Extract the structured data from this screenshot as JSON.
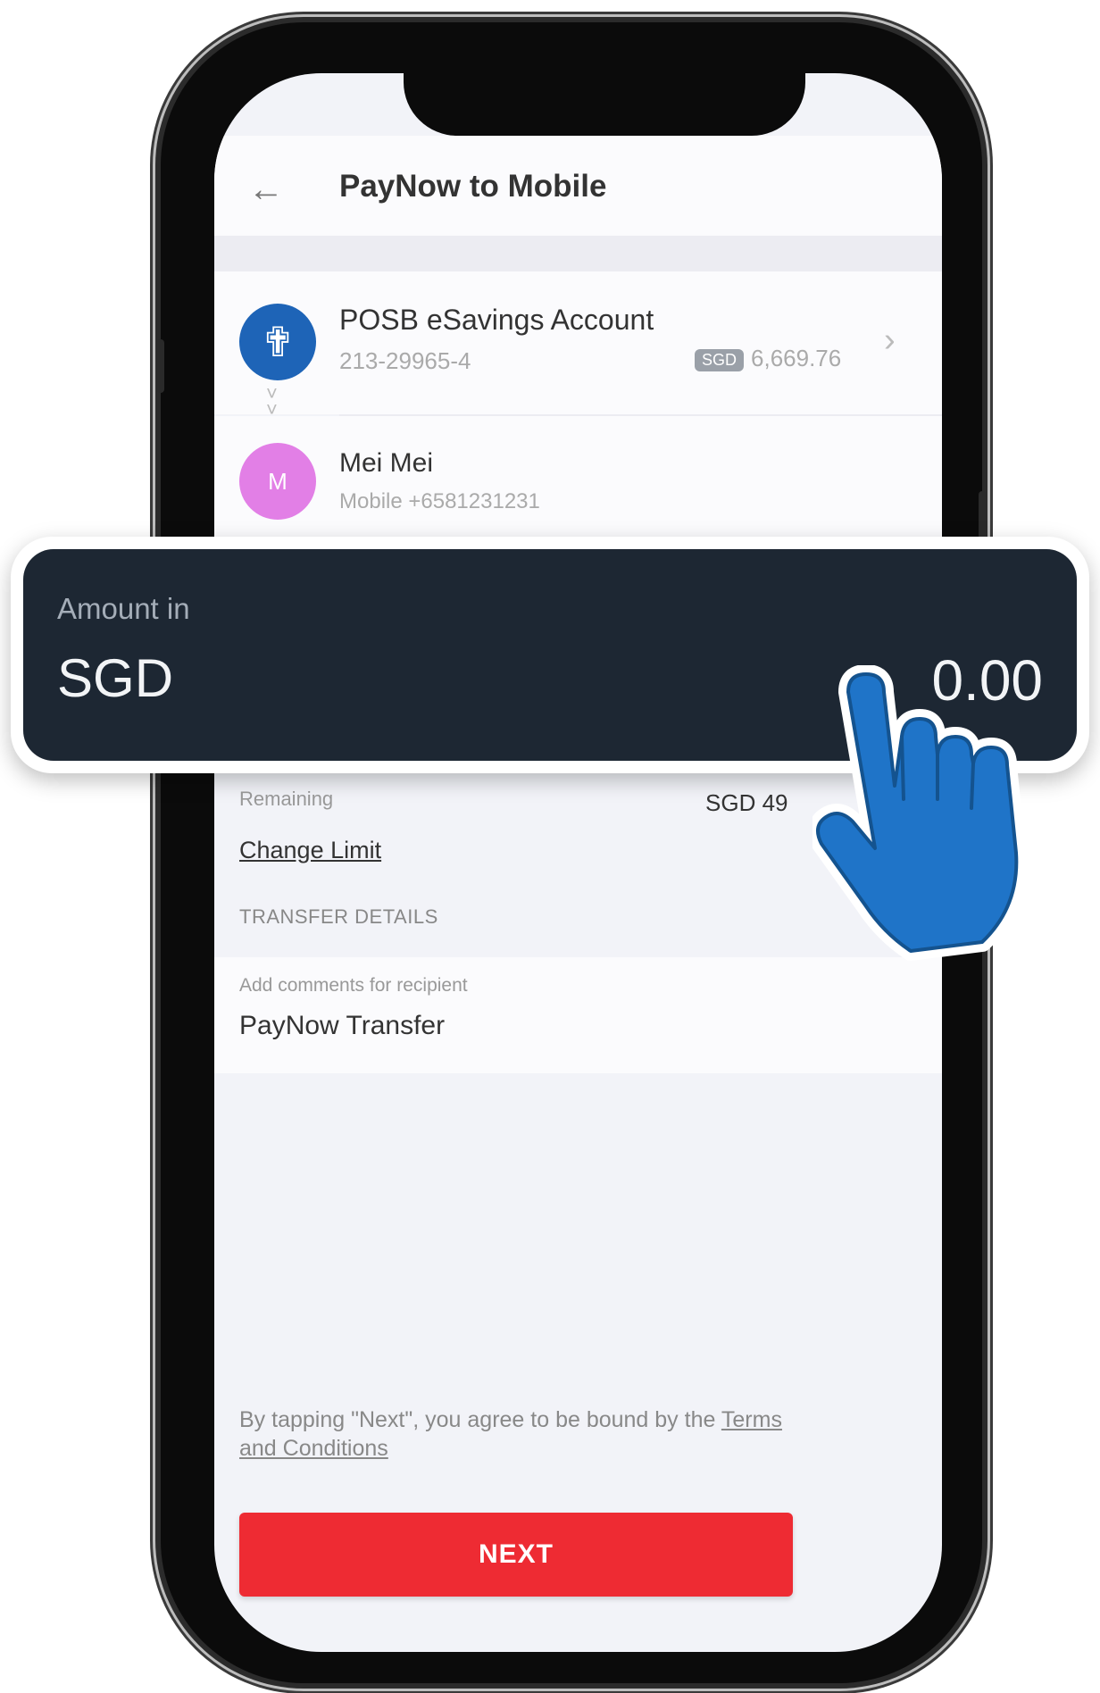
{
  "header": {
    "title": "PayNow to Mobile"
  },
  "from_account": {
    "name": "POSB eSavings Account",
    "number": "213-29965-4",
    "currency_badge": "SGD",
    "balance": "6,669.76"
  },
  "payee": {
    "initial": "M",
    "name": "Mei Mei",
    "mobile": "Mobile +6581231231"
  },
  "amount": {
    "label": "Amount in",
    "currency": "SGD",
    "value": "0.00"
  },
  "limit": {
    "remaining_label": "Remaining",
    "remaining_value": "SGD 49",
    "change_limit_label": "Change Limit"
  },
  "transfer_details": {
    "section_title": "TRANSFER DETAILS",
    "comments_label": "Add comments for recipient",
    "comments_value": "PayNow Transfer"
  },
  "footer": {
    "terms_prefix": "By tapping \"Next\", you agree to be bound by the ",
    "terms_link": "Terms and Conditions",
    "next_label": "NEXT"
  },
  "colors": {
    "accent_red": "#ee2b33",
    "posb_blue": "#1e64b7",
    "avatar_pink": "#e27fe6",
    "amount_panel": "#1d2733",
    "hand_blue": "#1f74c8"
  }
}
